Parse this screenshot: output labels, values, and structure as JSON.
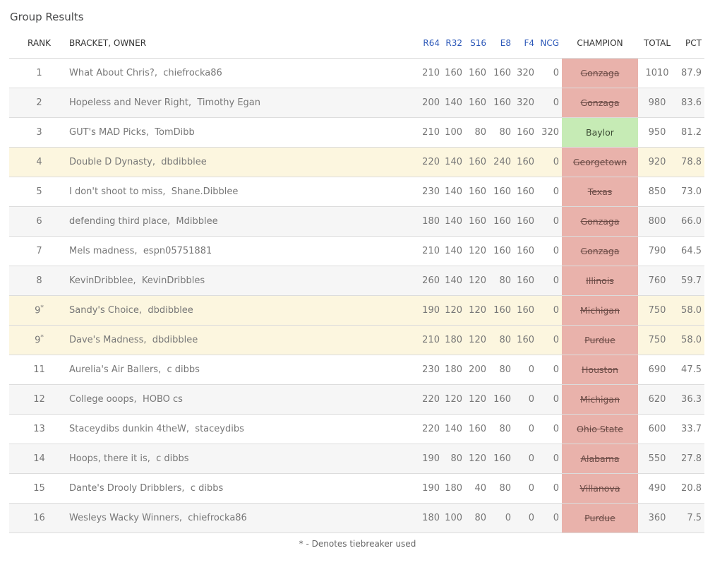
{
  "title": "Group Results",
  "columns": {
    "rank": "RANK",
    "bracket": "BRACKET, OWNER",
    "r64": "R64",
    "r32": "R32",
    "s16": "S16",
    "e8": "E8",
    "f4": "F4",
    "ncg": "NCG",
    "champion": "CHAMPION",
    "total": "TOTAL",
    "pct": "PCT"
  },
  "colors": {
    "link": "#2b57b8",
    "eliminated": "#e9b2ab",
    "alive": "#c6ebb5",
    "highlight": "#fcf6df"
  },
  "rows": [
    {
      "rank": "1",
      "bracket": "What About Chris?",
      "owner": "chiefrocka86",
      "r64": "210",
      "r32": "160",
      "s16": "160",
      "e8": "160",
      "f4": "320",
      "ncg": "0",
      "champion": "Gonzaga",
      "champion_alive": false,
      "total": "1010",
      "pct": "87.9"
    },
    {
      "rank": "2",
      "bracket": "Hopeless and Never Right",
      "owner": "Timothy Egan",
      "r64": "200",
      "r32": "140",
      "s16": "160",
      "e8": "160",
      "f4": "320",
      "ncg": "0",
      "champion": "Gonzaga",
      "champion_alive": false,
      "total": "980",
      "pct": "83.6"
    },
    {
      "rank": "3",
      "bracket": "GUT's MAD Picks",
      "owner": "TomDibb",
      "r64": "210",
      "r32": "100",
      "s16": "80",
      "e8": "80",
      "f4": "160",
      "ncg": "320",
      "champion": "Baylor",
      "champion_alive": true,
      "total": "950",
      "pct": "81.2"
    },
    {
      "rank": "4",
      "bracket": "Double D Dynasty",
      "owner": "dbdibblee",
      "r64": "220",
      "r32": "140",
      "s16": "160",
      "e8": "240",
      "f4": "160",
      "ncg": "0",
      "champion": "Georgetown",
      "champion_alive": false,
      "total": "920",
      "pct": "78.8"
    },
    {
      "rank": "5",
      "bracket": "I don't shoot to miss",
      "owner": "Shane.Dibblee",
      "r64": "230",
      "r32": "140",
      "s16": "160",
      "e8": "160",
      "f4": "160",
      "ncg": "0",
      "champion": "Texas",
      "champion_alive": false,
      "total": "850",
      "pct": "73.0"
    },
    {
      "rank": "6",
      "bracket": "defending third place",
      "owner": "Mdibblee",
      "r64": "180",
      "r32": "140",
      "s16": "160",
      "e8": "160",
      "f4": "160",
      "ncg": "0",
      "champion": "Gonzaga",
      "champion_alive": false,
      "total": "800",
      "pct": "66.0"
    },
    {
      "rank": "7",
      "bracket": "Mels madness",
      "owner": "espn05751881",
      "r64": "210",
      "r32": "140",
      "s16": "120",
      "e8": "160",
      "f4": "160",
      "ncg": "0",
      "champion": "Gonzaga",
      "champion_alive": false,
      "total": "790",
      "pct": "64.5"
    },
    {
      "rank": "8",
      "bracket": "KevinDribblee",
      "owner": "KevinDribbles",
      "r64": "260",
      "r32": "140",
      "s16": "120",
      "e8": "80",
      "f4": "160",
      "ncg": "0",
      "champion": "Illinois",
      "champion_alive": false,
      "total": "760",
      "pct": "59.7"
    },
    {
      "rank": "9",
      "rank_mark": "*",
      "bracket": "Sandy's Choice",
      "owner": "dbdibblee",
      "r64": "190",
      "r32": "120",
      "s16": "120",
      "e8": "160",
      "f4": "160",
      "ncg": "0",
      "champion": "Michigan",
      "champion_alive": false,
      "total": "750",
      "pct": "58.0"
    },
    {
      "rank": "9",
      "rank_mark": "*",
      "bracket": "Dave's Madness",
      "owner": "dbdibblee",
      "r64": "210",
      "r32": "180",
      "s16": "120",
      "e8": "80",
      "f4": "160",
      "ncg": "0",
      "champion": "Purdue",
      "champion_alive": false,
      "total": "750",
      "pct": "58.0"
    },
    {
      "rank": "11",
      "bracket": "Aurelia's Air Ballers",
      "owner": "c dibbs",
      "r64": "230",
      "r32": "180",
      "s16": "200",
      "e8": "80",
      "f4": "0",
      "ncg": "0",
      "champion": "Houston",
      "champion_alive": false,
      "total": "690",
      "pct": "47.5"
    },
    {
      "rank": "12",
      "bracket": "College ooops",
      "owner": "HOBO cs",
      "r64": "220",
      "r32": "120",
      "s16": "120",
      "e8": "160",
      "f4": "0",
      "ncg": "0",
      "champion": "Michigan",
      "champion_alive": false,
      "total": "620",
      "pct": "36.3"
    },
    {
      "rank": "13",
      "bracket": "Staceydibs dunkin 4theW",
      "owner": "staceydibs",
      "r64": "220",
      "r32": "140",
      "s16": "160",
      "e8": "80",
      "f4": "0",
      "ncg": "0",
      "champion": "Ohio State",
      "champion_alive": false,
      "total": "600",
      "pct": "33.7"
    },
    {
      "rank": "14",
      "bracket": "Hoops, there it is",
      "owner": "c dibbs",
      "r64": "190",
      "r32": "80",
      "s16": "120",
      "e8": "160",
      "f4": "0",
      "ncg": "0",
      "champion": "Alabama",
      "champion_alive": false,
      "total": "550",
      "pct": "27.8"
    },
    {
      "rank": "15",
      "bracket": "Dante's Drooly Dribblers",
      "owner": "c dibbs",
      "r64": "190",
      "r32": "180",
      "s16": "40",
      "e8": "80",
      "f4": "0",
      "ncg": "0",
      "champion": "Villanova",
      "champion_alive": false,
      "total": "490",
      "pct": "20.8"
    },
    {
      "rank": "16",
      "bracket": "Wesleys Wacky Winners",
      "owner": "chiefrocka86",
      "r64": "180",
      "r32": "100",
      "s16": "80",
      "e8": "0",
      "f4": "0",
      "ncg": "0",
      "champion": "Purdue",
      "champion_alive": false,
      "total": "360",
      "pct": "7.5"
    }
  ],
  "footnote": "* - Denotes tiebreaker used"
}
